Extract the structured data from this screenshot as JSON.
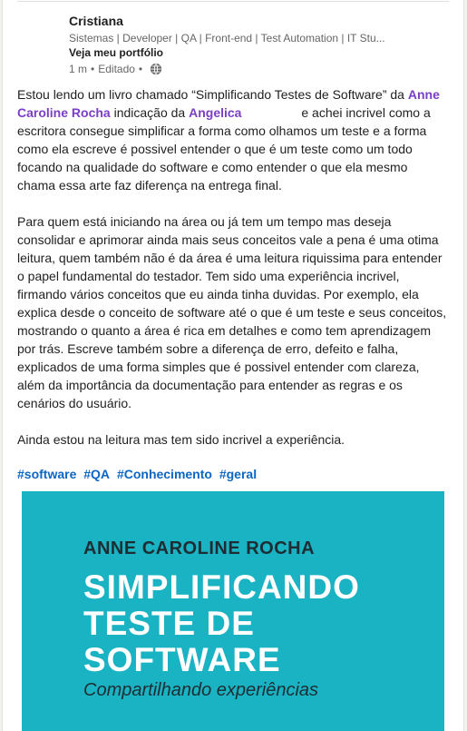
{
  "author": {
    "name": "Cristiana",
    "headline": "Sistemas | Developer | QA | Front-end | Test Automation | IT Stu...",
    "portfolio_label": "Veja meu portfólio",
    "time": "1 m",
    "edited": "Editado",
    "separator": "•",
    "visibility_icon": "globe-icon"
  },
  "post": {
    "p1_a": "Estou lendo um livro chamado “Simplificando Testes de Software” da ",
    "mention1": "Anne Caroline Rocha",
    "p1_b": " indicação da ",
    "mention2": "Angelica",
    "p1_c": " e achei incrivel como a escritora consegue simplificar a forma como olhamos um teste e a forma como ela escreve é possivel entender o que é um teste como um todo focando na qualidade do software e como entender o que ela mesmo chama essa arte faz diferença na entrega final.",
    "p2": "Para quem está iniciando na área ou já tem um tempo mas deseja consolidar e aprimorar ainda mais seus conceitos vale a pena é uma otima leitura, quem também não é da área é uma leitura riquissima para entender o papel fundamental do testador. Tem sido uma experiência incrivel, firmando vários conceitos que eu ainda tinha duvidas. Por exemplo, ela explica desde o conceito de software até o que é um teste e seus conceitos, mostrando o quanto a área é rica em detalhes e como tem aprendizagem por trás. Escreve também sobre a diferença de erro, defeito e falha, explicados de uma forma simples que é possivel entender com clareza, além da importância da documentação para entender as regras e os cenários do usuário.",
    "p3": "Ainda estou na leitura mas tem sido incrivel a experiência.",
    "hashtags": [
      "#software",
      "#QA",
      "#Conhecimento",
      "#geral"
    ]
  },
  "book": {
    "author": "ANNE CAROLINE ROCHA",
    "title_line1": "SIMPLIFICANDO",
    "title_line2": "TESTE DE",
    "title_line3": "SOFTWARE",
    "subtitle": "Compartilhando experiências"
  },
  "colors": {
    "mention": "#7a3fc4",
    "hashtag": "#0a66c2",
    "book_cover": "#1ab3c3"
  }
}
